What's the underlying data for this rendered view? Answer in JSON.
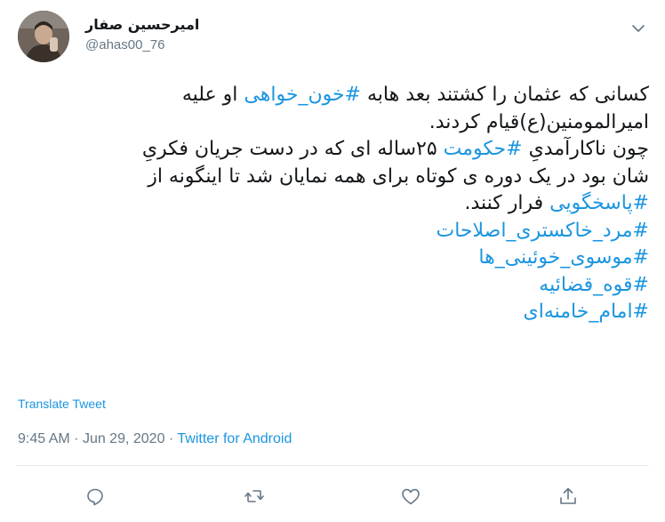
{
  "user": {
    "display_name": "امیرحسین صفار",
    "handle": "@ahas00_76"
  },
  "tweet": {
    "lines": [
      [
        {
          "text": "کسانی که عثمان را کشتند بعد هابه ",
          "hashtag": false
        },
        {
          "text": "#خون_خواهی",
          "hashtag": true
        },
        {
          "text": " او علیه",
          "hashtag": false
        }
      ],
      [
        {
          "text": "امیرالمومنین(ع)قیام کردند.",
          "hashtag": false
        }
      ],
      [
        {
          "text": "چون ناکارآمدیِ ",
          "hashtag": false
        },
        {
          "text": "#حکومت",
          "hashtag": true
        },
        {
          "text": " ۲۵ساله ای که در دست جریان فکریِ",
          "hashtag": false
        }
      ],
      [
        {
          "text": "شان بود در یک دوره ی کوتاه برای همه نمایان شد تا اینگونه از",
          "hashtag": false
        }
      ],
      [
        {
          "text": "#پاسخگویی",
          "hashtag": true
        },
        {
          "text": " فرار کنند.",
          "hashtag": false
        }
      ],
      [
        {
          "text": "#مرد_خاکستری_اصلاحات",
          "hashtag": true
        }
      ],
      [
        {
          "text": "#موسوی_خوئینی_ها",
          "hashtag": true
        }
      ],
      [
        {
          "text": "#قوه_قضائیه",
          "hashtag": true
        }
      ],
      [
        {
          "text": "#امام_خامنه‌ای",
          "hashtag": true
        }
      ]
    ],
    "translate_label": "Translate Tweet",
    "time": "9:45 AM",
    "separator": "·",
    "date": "Jun 29, 2020",
    "source": "Twitter for Android"
  },
  "actions": {
    "reply_icon": "reply-icon",
    "retweet_icon": "retweet-icon",
    "like_icon": "heart-icon",
    "share_icon": "share-icon"
  },
  "colors": {
    "link": "#1b95e0",
    "text": "#14171a",
    "muted": "#657786",
    "divider": "#e6ecf0"
  }
}
